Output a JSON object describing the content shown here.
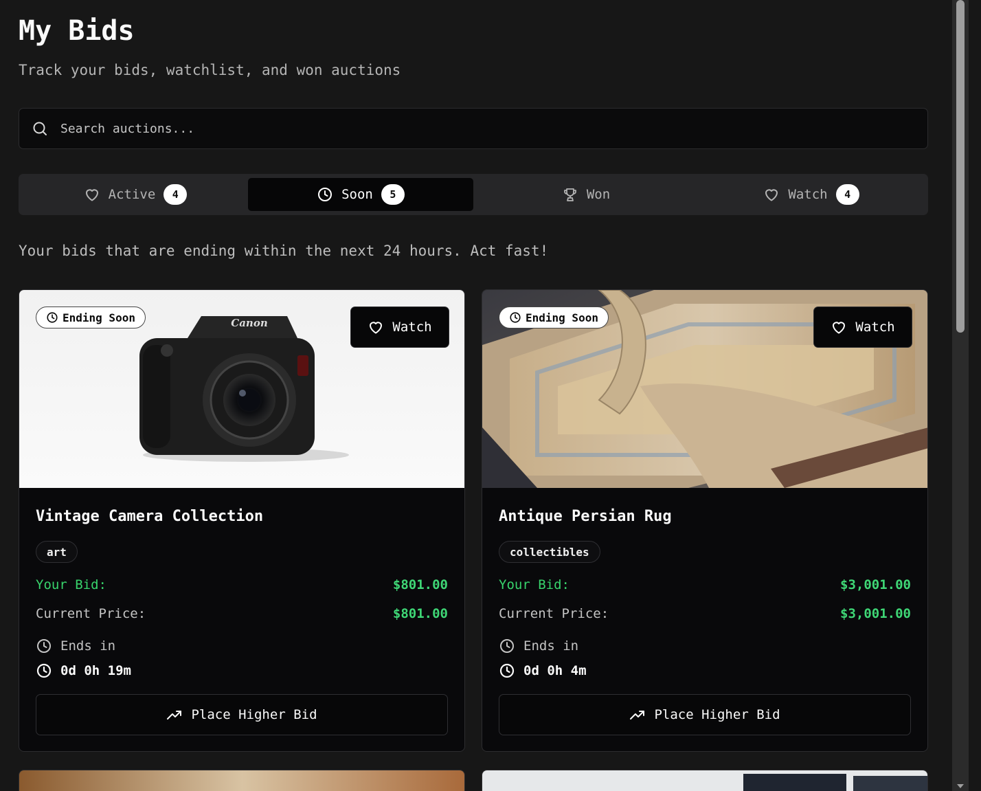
{
  "header": {
    "title": "My Bids",
    "subtitle": "Track your bids, watchlist, and won auctions"
  },
  "search": {
    "placeholder": "Search auctions..."
  },
  "tabs": [
    {
      "label": "Active",
      "count": "4",
      "icon": "heart-icon",
      "active": false
    },
    {
      "label": "Soon",
      "count": "5",
      "icon": "clock-icon",
      "active": true
    },
    {
      "label": "Won",
      "count": null,
      "icon": "trophy-icon",
      "active": false
    },
    {
      "label": "Watch",
      "count": "4",
      "icon": "heart-icon",
      "active": false
    }
  ],
  "description": "Your bids that are ending within the next 24 hours. Act fast!",
  "cards": [
    {
      "badge": "Ending Soon",
      "watch_label": "Watch",
      "title": "Vintage Camera Collection",
      "category": "art",
      "your_bid_label": "Your Bid:",
      "your_bid": "$801.00",
      "current_price_label": "Current Price:",
      "current_price": "$801.00",
      "ends_label": "Ends in",
      "countdown": "0d 0h 19m",
      "action_label": "Place Higher Bid",
      "image": "camera-photo"
    },
    {
      "badge": "Ending Soon",
      "watch_label": "Watch",
      "title": "Antique Persian Rug",
      "category": "collectibles",
      "your_bid_label": "Your Bid:",
      "your_bid": "$3,001.00",
      "current_price_label": "Current Price:",
      "current_price": "$3,001.00",
      "ends_label": "Ends in",
      "countdown": "0d 0h 4m",
      "action_label": "Place Higher Bid",
      "image": "rug-photo"
    }
  ],
  "colors": {
    "background": "#171717",
    "card": "#09090b",
    "accent_green": "#3fd776",
    "tab_bar": "#262628"
  }
}
